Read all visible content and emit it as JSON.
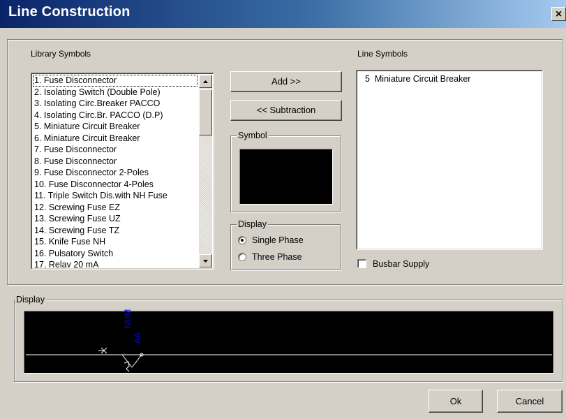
{
  "window": {
    "title": "Line Construction",
    "close_glyph": "×"
  },
  "library": {
    "label": "Library Symbols",
    "items": [
      "1. Fuse Disconnector",
      "2. Isolating Switch (Double Pole)",
      "3. Isolating Circ.Breaker PACCO",
      "4. Isolating Circ.Br. PACCO (D.P)",
      "5. Miniature Circuit Breaker",
      "6. Miniature Circuit Breaker",
      "7. Fuse Disconnector",
      "8. Fuse Disconnector",
      "9. Fuse Disconnector 2-Poles",
      "10. Fuse Disconnector 4-Poles",
      "11. Triple Switch Dis.with NH Fuse",
      "12. Screwing Fuse EZ",
      "13. Screwing Fuse UZ",
      "14. Screwing Fuse TZ",
      "15. Knife Fuse NH",
      "16. Pulsatory Switch",
      "17. Relay 20 mA"
    ]
  },
  "buttons": {
    "add": "Add >>",
    "subtraction": "<< Subtraction",
    "ok": "Ok",
    "cancel": "Cancel"
  },
  "symbol_group": {
    "label": "Symbol"
  },
  "display_group": {
    "label": "Display",
    "options": [
      "Single Phase",
      "Three Phase"
    ],
    "selected": "Single Phase"
  },
  "line_symbols": {
    "label": "Line Symbols",
    "items": [
      "5  Miniature Circuit Breaker"
    ]
  },
  "busbar": {
    "label": "Busbar Supply",
    "checked": false
  },
  "display_panel": {
    "label": "Display",
    "annotation_top": "NUM",
    "annotation_bottom": "AA"
  },
  "colors": {
    "canvas": "#000000",
    "annotation": "#0000ff",
    "line": "#ffffff"
  }
}
